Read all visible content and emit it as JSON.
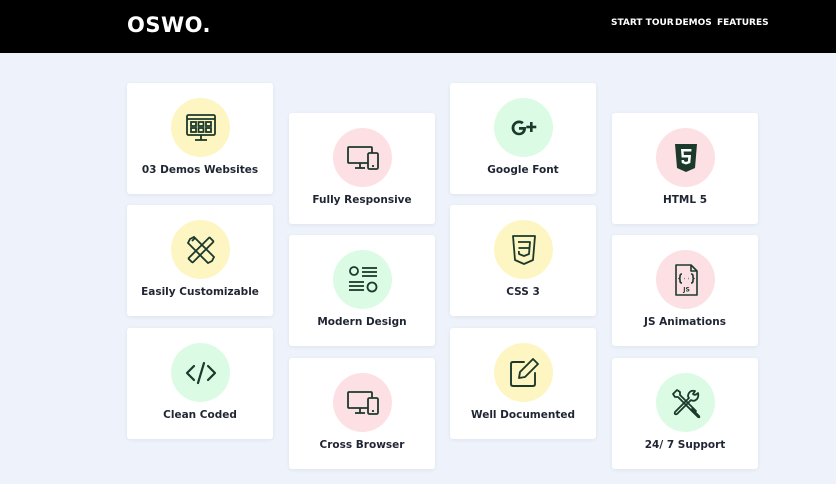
{
  "header": {
    "logo": "OSWO.",
    "nav": [
      "START TOUR",
      "DEMOS",
      "FEATURES"
    ]
  },
  "colors": {
    "header_bg": "#000000",
    "page_bg": "#eef3fb",
    "yellow": "#fdf6c3",
    "pink": "#fde0e4",
    "green": "#dcfbe4",
    "icon_stroke": "#1b3a2c"
  },
  "features": [
    {
      "label": "03 Demos Websites",
      "icon": "monitor-grid-icon",
      "color": "yellow"
    },
    {
      "label": "Easily Customizable",
      "icon": "pencil-ruler-icon",
      "color": "yellow"
    },
    {
      "label": "Clean Coded",
      "icon": "code-icon",
      "color": "green"
    },
    {
      "label": "Fully Responsive",
      "icon": "devices-icon",
      "color": "pink"
    },
    {
      "label": "Modern Design",
      "icon": "layout-icon",
      "color": "green"
    },
    {
      "label": "Cross Browser",
      "icon": "devices-icon",
      "color": "pink"
    },
    {
      "label": "Google Font",
      "icon": "google-plus-icon",
      "color": "green"
    },
    {
      "label": "CSS 3",
      "icon": "css3-icon",
      "color": "yellow"
    },
    {
      "label": "Well Documented",
      "icon": "edit-icon",
      "color": "yellow"
    },
    {
      "label": "HTML 5",
      "icon": "html5-icon",
      "color": "pink"
    },
    {
      "label": "JS Animations",
      "icon": "js-file-icon",
      "color": "pink"
    },
    {
      "label": "24/ 7 Support",
      "icon": "tools-icon",
      "color": "green"
    }
  ]
}
